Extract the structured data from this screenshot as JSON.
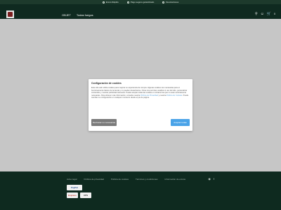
{
  "topbar": {
    "items": [
      {
        "icon": "truck-icon",
        "text": "Envío Rápido"
      },
      {
        "icon": "shield-icon",
        "text": "Pago seguro garantizado"
      },
      {
        "icon": "refresh-icon",
        "text": "Devoluciones"
      }
    ]
  },
  "header": {
    "nav": [
      "OBJET",
      "Todas fuegos"
    ],
    "cart_count": "0"
  },
  "cookie_modal": {
    "title": "Configuración de cookies",
    "body_parts": [
      "Este sitio web utiliza cookies para mejorar su experiencia de compra. Algunas cookies son necesarias para el funcionamiento básico de la tienda y no pueden desactivarse. Otras nos permiten analizar el uso del sitio, personalizar contenidos y mostrar publicidad relevante. Puede aceptar todas las cookies o rechazar las que no sean estrictamente necesarias. Para obtener más información, consulte nuestra ",
      "Política de Privacidad",
      " y nuestra ",
      "Política de Cookies",
      ". Puede cambiar su configuración en cualquier momento desde el pie de página."
    ],
    "reject_label": "Rechazar no necesarias",
    "accept_label": "Aceptar todas"
  },
  "footer": {
    "links": [
      "Aviso legal",
      "Política de privacidad",
      "Política de cookies",
      "Términos y condiciones",
      "Información de envíos"
    ],
    "payments": [
      "PayPal",
      "Express",
      "UPS"
    ]
  },
  "colors": {
    "header_bg": "#0f2a20",
    "topbar_bg": "#1d3a2c",
    "footer_bg": "#0e2a1f",
    "accept_button": "#4aa3e8",
    "reject_button": "#7a7a7a",
    "overlay": "#c6c6c6"
  }
}
